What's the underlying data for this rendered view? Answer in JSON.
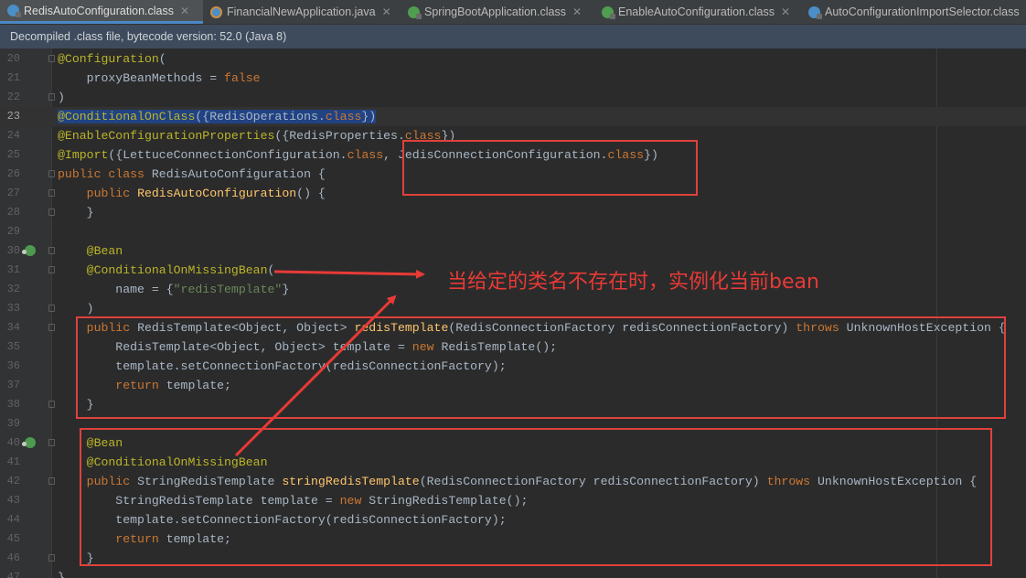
{
  "tabs": [
    {
      "label": "RedisAutoConfiguration.class",
      "icon": "class-file-icon",
      "active": true,
      "closable": true
    },
    {
      "label": "FinancialNewApplication.java",
      "icon": "java-file-icon",
      "active": false,
      "closable": true
    },
    {
      "label": "SpringBootApplication.class",
      "icon": "annotation-class-icon",
      "active": false,
      "closable": true
    },
    {
      "label": "EnableAutoConfiguration.class",
      "icon": "annotation-class-icon",
      "active": false,
      "closable": true
    },
    {
      "label": "AutoConfigurationImportSelector.class",
      "icon": "class-file-icon",
      "active": false,
      "closable": false
    }
  ],
  "info_bar": "Decompiled .class file, bytecode version: 52.0 (Java 8)",
  "annotation": {
    "text": "当给定的类名不存在时，实例化当前bean",
    "color": "#e83a36"
  },
  "code_lines": [
    {
      "n": "20",
      "parts": [
        [
          "an",
          "@Configuration"
        ],
        [
          "",
          "("
        ]
      ]
    },
    {
      "n": "21",
      "parts": [
        [
          "",
          "    proxyBeanMethods = "
        ],
        [
          "kw",
          "false"
        ]
      ]
    },
    {
      "n": "22",
      "parts": [
        [
          "",
          ")"
        ]
      ]
    },
    {
      "n": "23",
      "parts": [
        [
          "an sel",
          "@ConditionalOnClass"
        ],
        [
          "sel",
          "({RedisOperations."
        ],
        [
          "kw sel",
          "class"
        ],
        [
          "sel",
          "})"
        ]
      ]
    },
    {
      "n": "24",
      "parts": [
        [
          "an",
          "@EnableConfigurationProperties"
        ],
        [
          "",
          "({RedisProperties."
        ],
        [
          "kw",
          "class"
        ],
        [
          "",
          "})"
        ]
      ]
    },
    {
      "n": "25",
      "parts": [
        [
          "an",
          "@Import"
        ],
        [
          "",
          "({LettuceConnectionConfiguration."
        ],
        [
          "kw",
          "class"
        ],
        [
          "",
          ", JedisConnectionConfiguration."
        ],
        [
          "kw",
          "class"
        ],
        [
          "",
          "})"
        ]
      ]
    },
    {
      "n": "26",
      "parts": [
        [
          "kw",
          "public class "
        ],
        [
          "",
          "RedisAutoConfiguration {"
        ]
      ]
    },
    {
      "n": "27",
      "parts": [
        [
          "kw",
          "    public "
        ],
        [
          "fn",
          "RedisAutoConfiguration"
        ],
        [
          "",
          "() {"
        ]
      ]
    },
    {
      "n": "28",
      "parts": [
        [
          "",
          "    }"
        ]
      ]
    },
    {
      "n": "29",
      "parts": []
    },
    {
      "n": "30",
      "parts": [
        [
          "an",
          "    @Bean"
        ]
      ]
    },
    {
      "n": "31",
      "parts": [
        [
          "an",
          "    @ConditionalOnMissingBean"
        ],
        [
          "",
          "("
        ]
      ]
    },
    {
      "n": "32",
      "parts": [
        [
          "",
          "        name = {"
        ],
        [
          "st",
          "\"redisTemplate\""
        ],
        [
          "",
          "}"
        ]
      ]
    },
    {
      "n": "33",
      "parts": [
        [
          "",
          "    )"
        ]
      ]
    },
    {
      "n": "34",
      "parts": [
        [
          "kw",
          "    public "
        ],
        [
          "",
          "RedisTemplate<Object, Object> "
        ],
        [
          "fn",
          "redisTemplate"
        ],
        [
          "",
          "(RedisConnectionFactory redisConnectionFactory) "
        ],
        [
          "kw",
          "throws "
        ],
        [
          "",
          "UnknownHostException {"
        ]
      ]
    },
    {
      "n": "35",
      "parts": [
        [
          "",
          "        RedisTemplate<Object, Object> template = "
        ],
        [
          "kw",
          "new "
        ],
        [
          "",
          "RedisTemplate();"
        ]
      ]
    },
    {
      "n": "36",
      "parts": [
        [
          "",
          "        template.setConnectionFactory(redisConnectionFactory);"
        ]
      ]
    },
    {
      "n": "37",
      "parts": [
        [
          "kw",
          "        return "
        ],
        [
          "",
          "template;"
        ]
      ]
    },
    {
      "n": "38",
      "parts": [
        [
          "",
          "    }"
        ]
      ]
    },
    {
      "n": "39",
      "parts": []
    },
    {
      "n": "40",
      "parts": [
        [
          "an",
          "    @Bean"
        ]
      ]
    },
    {
      "n": "41",
      "parts": [
        [
          "an",
          "    @ConditionalOnMissingBean"
        ]
      ]
    },
    {
      "n": "42",
      "parts": [
        [
          "kw",
          "    public "
        ],
        [
          "",
          "StringRedisTemplate "
        ],
        [
          "fn",
          "stringRedisTemplate"
        ],
        [
          "",
          "(RedisConnectionFactory redisConnectionFactory) "
        ],
        [
          "kw",
          "throws "
        ],
        [
          "",
          "UnknownHostException {"
        ]
      ]
    },
    {
      "n": "43",
      "parts": [
        [
          "",
          "        StringRedisTemplate template = "
        ],
        [
          "kw",
          "new "
        ],
        [
          "",
          "StringRedisTemplate();"
        ]
      ]
    },
    {
      "n": "44",
      "parts": [
        [
          "",
          "        template.setConnectionFactory(redisConnectionFactory);"
        ]
      ]
    },
    {
      "n": "45",
      "parts": [
        [
          "kw",
          "        return "
        ],
        [
          "",
          "template;"
        ]
      ]
    },
    {
      "n": "46",
      "parts": [
        [
          "",
          "    }"
        ]
      ]
    },
    {
      "n": "47",
      "parts": [
        [
          "",
          "}"
        ]
      ]
    }
  ],
  "caret_line": "23",
  "gutter_icon_lines": [
    "30",
    "40"
  ],
  "fold_marker_lines": [
    "20",
    "22",
    "26",
    "27",
    "28",
    "30",
    "31",
    "33",
    "34",
    "38",
    "40",
    "42",
    "46"
  ]
}
